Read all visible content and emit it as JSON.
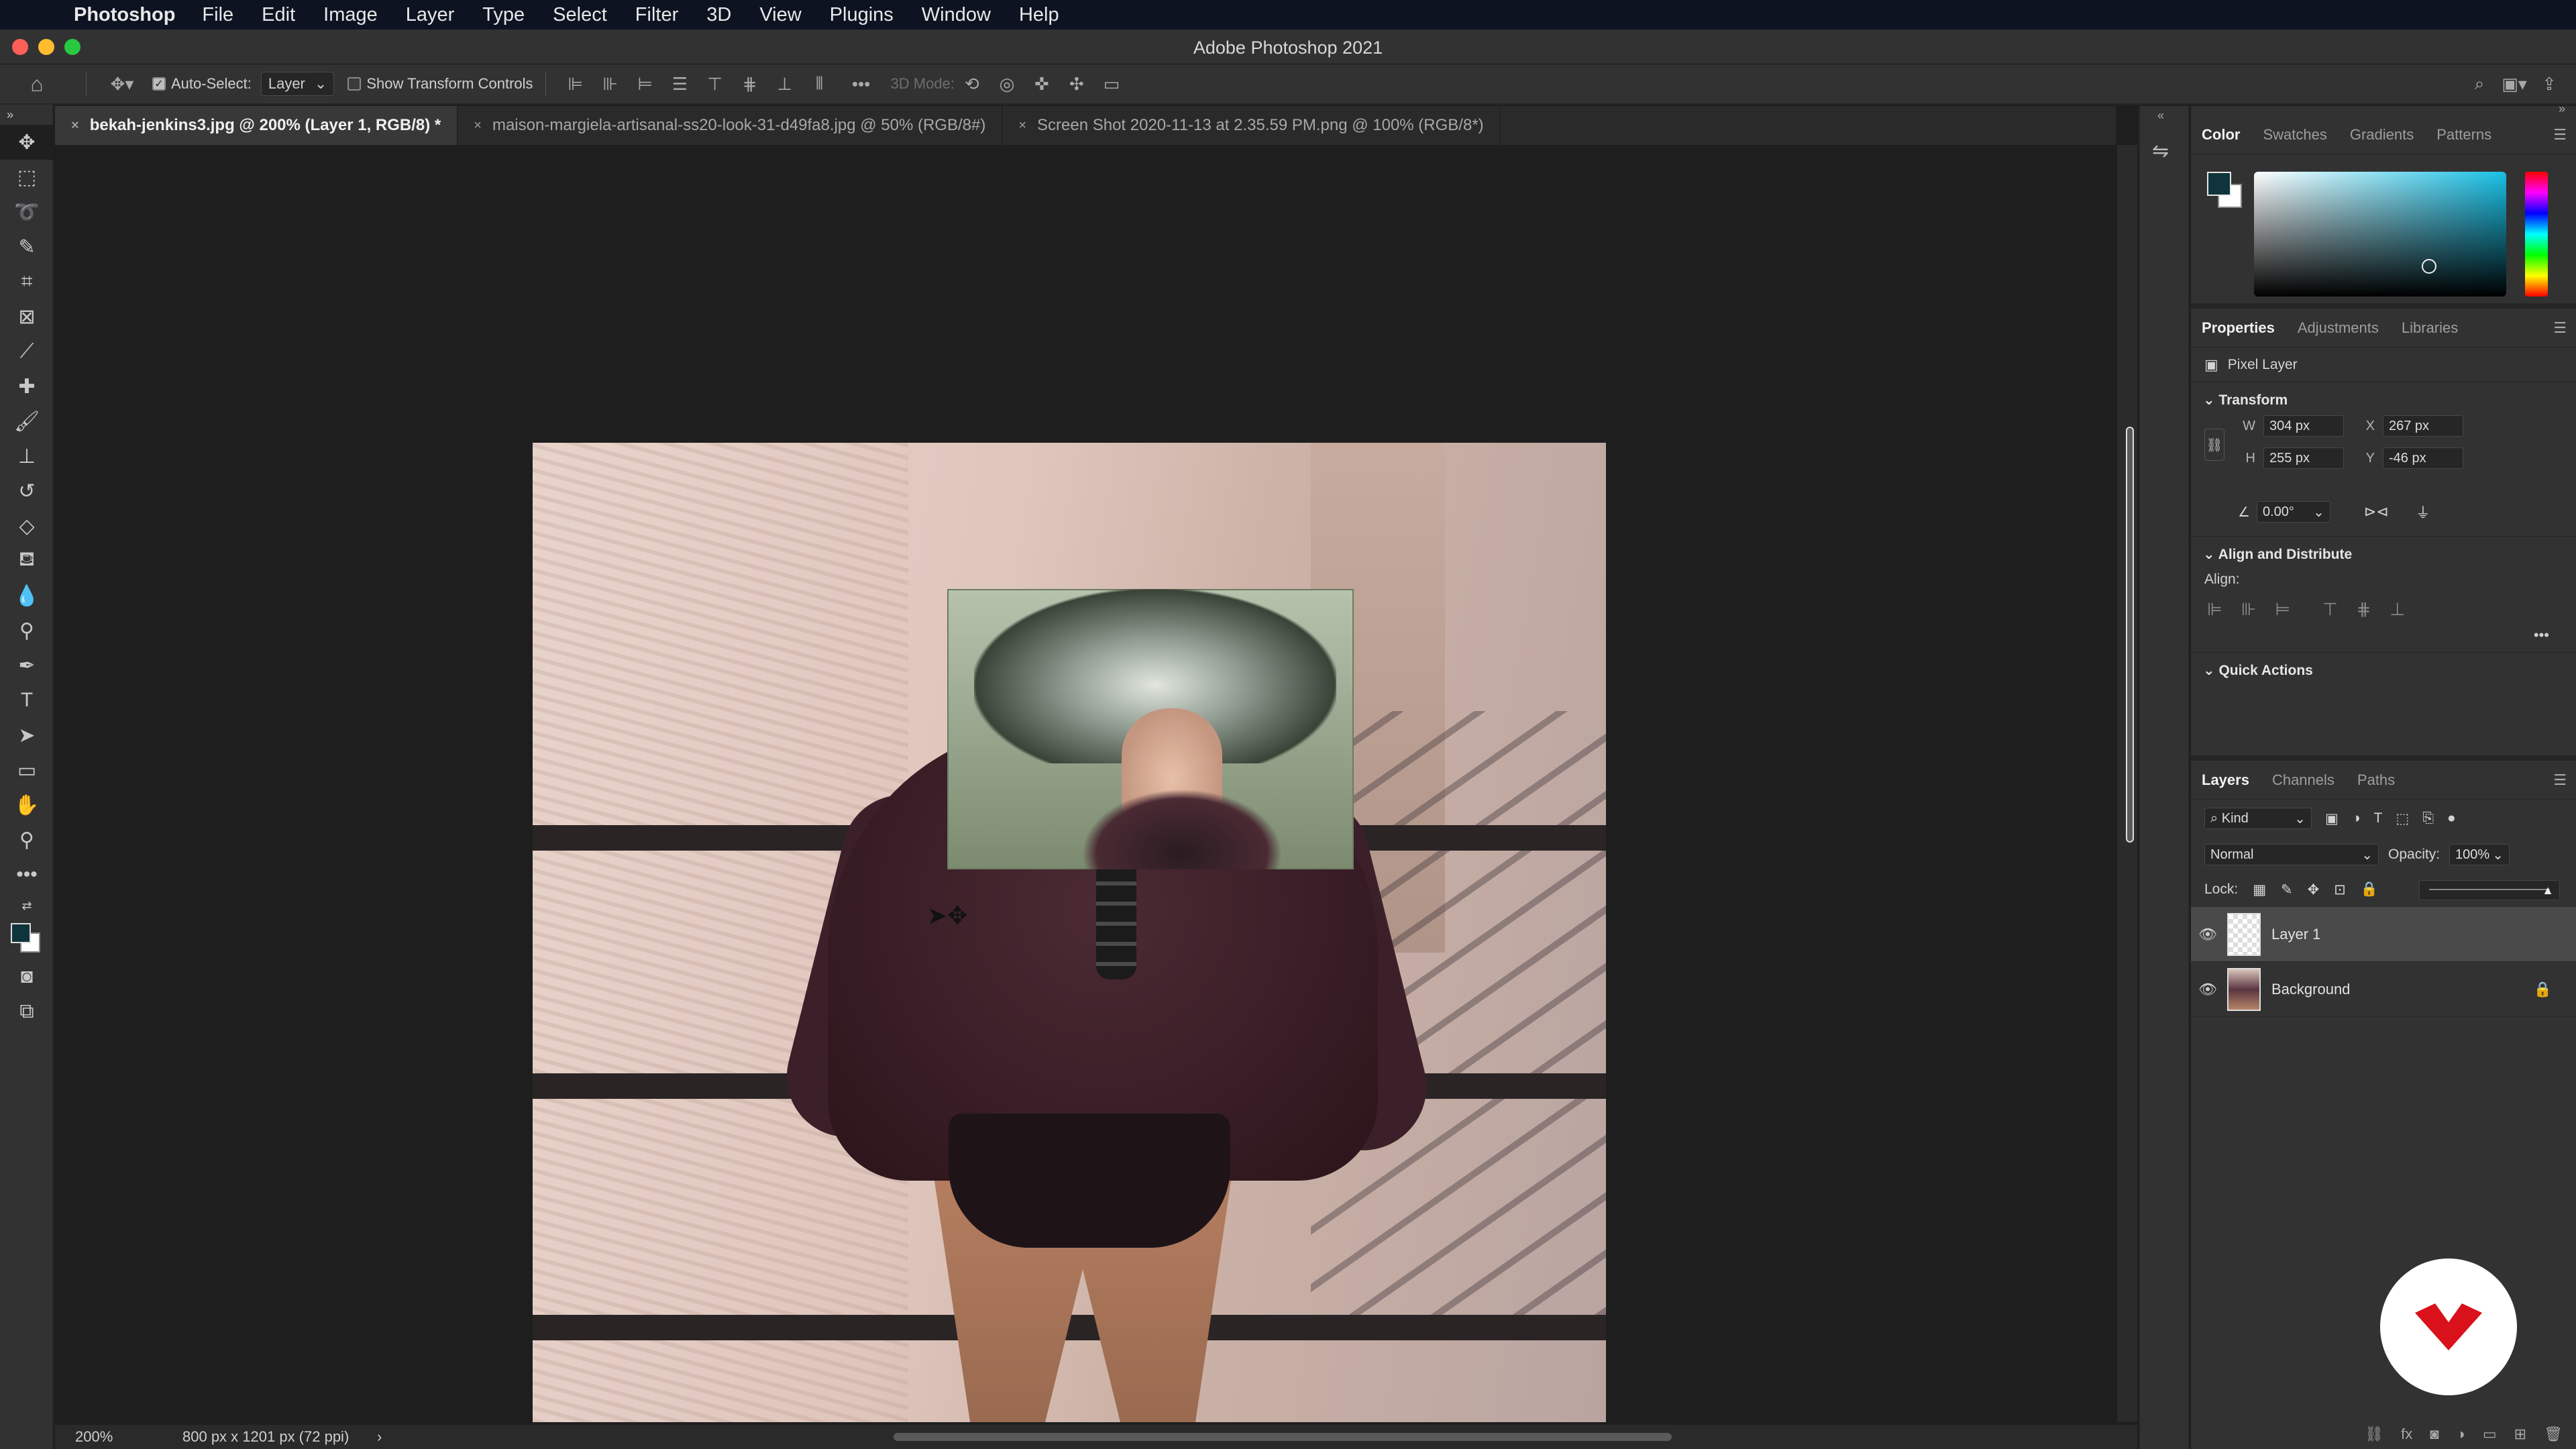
{
  "menubar": {
    "app_name": "Photoshop",
    "items": [
      "File",
      "Edit",
      "Image",
      "Layer",
      "Type",
      "Select",
      "Filter",
      "3D",
      "View",
      "Plugins",
      "Window",
      "Help"
    ]
  },
  "window": {
    "title": "Adobe Photoshop 2021"
  },
  "options": {
    "auto_select_label": "Auto-Select:",
    "auto_select_checked": true,
    "auto_select_target": "Layer",
    "show_transform_label": "Show Transform Controls",
    "show_transform_checked": false,
    "mode_3d_label": "3D Mode:"
  },
  "tabs": [
    {
      "label": "bekah-jenkins3.jpg @ 200% (Layer 1, RGB/8) *",
      "active": true
    },
    {
      "label": "maison-margiela-artisanal-ss20-look-31-d49fa8.jpg @ 50% (RGB/8#)",
      "active": false
    },
    {
      "label": "Screen Shot 2020-11-13 at 2.35.59 PM.png @ 100% (RGB/8*)",
      "active": false
    }
  ],
  "status": {
    "zoom": "200%",
    "doc_size": "800 px x 1201 px (72 ppi)"
  },
  "color_panel": {
    "tabs": [
      "Color",
      "Swatches",
      "Gradients",
      "Patterns"
    ],
    "foreground": "#10343b",
    "background": "#ffffff"
  },
  "properties": {
    "tabs": [
      "Properties",
      "Adjustments",
      "Libraries"
    ],
    "layer_type": "Pixel Layer",
    "transform_title": "Transform",
    "w_label": "W",
    "w": "304 px",
    "h_label": "H",
    "h": "255 px",
    "x_label": "X",
    "x": "267 px",
    "y_label": "Y",
    "y": "-46 px",
    "angle": "0.00°",
    "align_title": "Align and Distribute",
    "align_label": "Align:",
    "quick_actions_title": "Quick Actions"
  },
  "layers": {
    "tabs": [
      "Layers",
      "Channels",
      "Paths"
    ],
    "filter_kind": "Kind",
    "blend_mode": "Normal",
    "opacity_label": "Opacity:",
    "opacity": "100%",
    "lock_label": "Lock:",
    "items": [
      {
        "name": "Layer 1",
        "selected": true
      },
      {
        "name": "Background",
        "selected": false,
        "locked": true
      }
    ]
  },
  "colors": {
    "accent": "#d9111a"
  }
}
